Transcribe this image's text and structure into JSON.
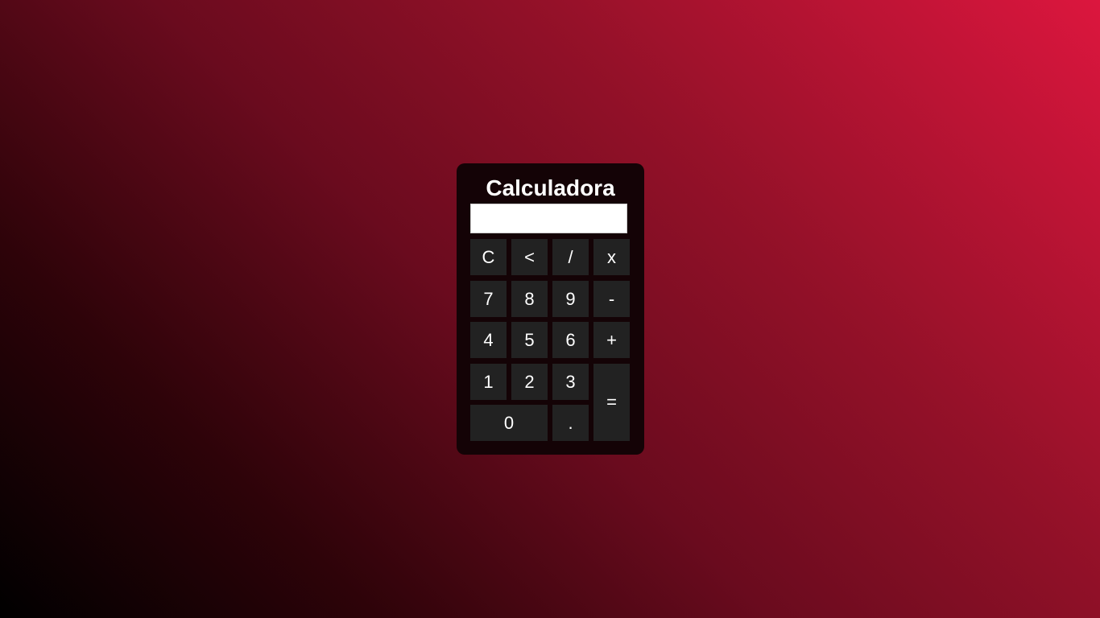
{
  "calculator": {
    "title": "Calculadora",
    "display_value": "",
    "buttons": {
      "clear": "C",
      "backspace": "<",
      "divide": "/",
      "multiply": "x",
      "seven": "7",
      "eight": "8",
      "nine": "9",
      "minus": "-",
      "four": "4",
      "five": "5",
      "six": "6",
      "plus": "+",
      "one": "1",
      "two": "2",
      "three": "3",
      "equals": "=",
      "zero": "0",
      "decimal": "."
    }
  },
  "colors": {
    "background_gradient_start": "#000000",
    "background_gradient_end": "#dc163e",
    "panel": "#140306",
    "button": "#222222",
    "button_text": "#ffffff",
    "display": "#ffffff"
  }
}
